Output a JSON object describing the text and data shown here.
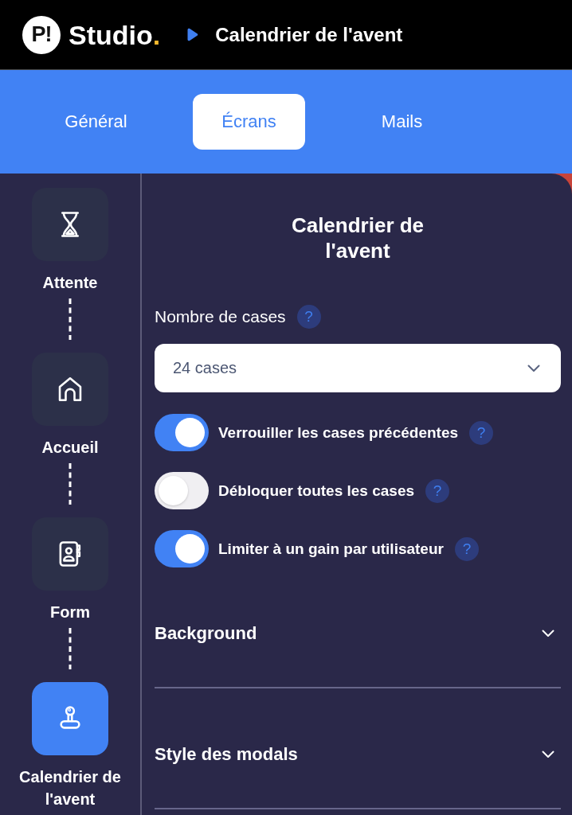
{
  "header": {
    "logo_mark": "P!",
    "brand": "Studio",
    "brand_dot": ".",
    "title": "Calendrier de l'avent"
  },
  "tabs": [
    {
      "label": "Général",
      "selected": false
    },
    {
      "label": "Écrans",
      "selected": true
    },
    {
      "label": "Mails",
      "selected": false
    }
  ],
  "sidebar": {
    "items": [
      {
        "label": "Attente",
        "selected": false
      },
      {
        "label": "Accueil",
        "selected": false
      },
      {
        "label": "Form",
        "selected": false
      },
      {
        "label": "Calendrier de l'avent",
        "selected": true
      }
    ]
  },
  "panel": {
    "title": "Calendrier de l'avent",
    "field": {
      "label": "Nombre de cases",
      "help": "?",
      "value": "24 cases"
    },
    "toggles": [
      {
        "label": "Verrouiller les cases précédentes",
        "on": true,
        "help": "?"
      },
      {
        "label": "Débloquer toutes les cases",
        "on": false,
        "help": "?"
      },
      {
        "label": "Limiter à un gain par utilisateur",
        "on": true,
        "help": "?"
      }
    ],
    "sections": [
      {
        "title": "Background",
        "expanded": false
      },
      {
        "title": "Style des modals",
        "expanded": false
      }
    ]
  }
}
